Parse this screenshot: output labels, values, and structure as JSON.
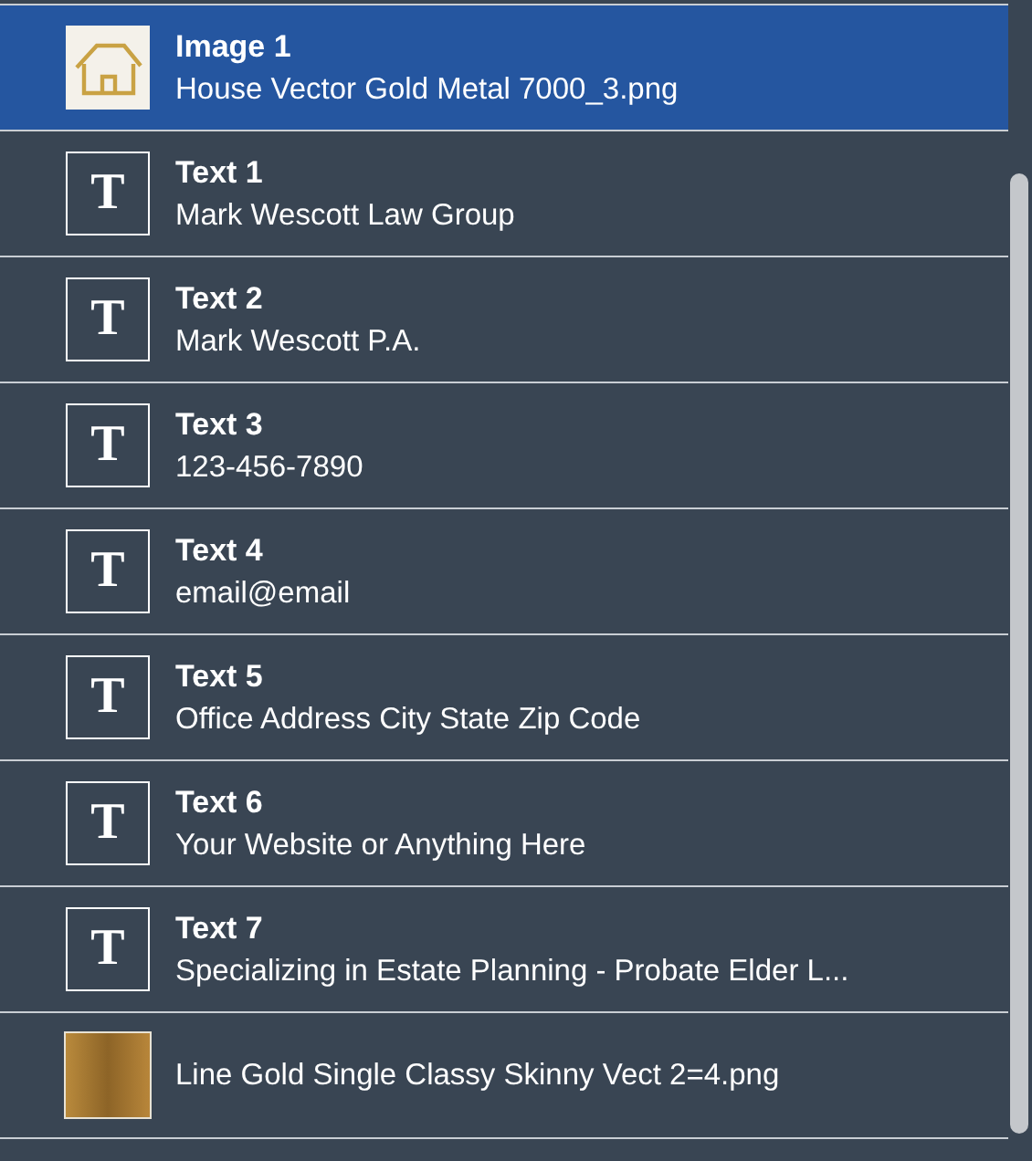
{
  "layers": [
    {
      "kind": "image",
      "title": "Image 1",
      "name": "House Vector Gold Metal 7000_3.png",
      "selected": true
    },
    {
      "kind": "text",
      "glyph": "T",
      "title": "Text 1",
      "name": "Mark Wescott Law Group",
      "selected": false
    },
    {
      "kind": "text",
      "glyph": "T",
      "title": "Text 2",
      "name": "Mark Wescott P.A.",
      "selected": false
    },
    {
      "kind": "text",
      "glyph": "T",
      "title": "Text 3",
      "name": "123-456-7890",
      "selected": false
    },
    {
      "kind": "text",
      "glyph": "T",
      "title": "Text 4",
      "name": "email@email",
      "selected": false
    },
    {
      "kind": "text",
      "glyph": "T",
      "title": "Text 5",
      "name": "Office Address City State Zip Code",
      "selected": false
    },
    {
      "kind": "text",
      "glyph": "T",
      "title": "Text 6",
      "name": "Your Website or Anything Here",
      "selected": false
    },
    {
      "kind": "text",
      "glyph": "T",
      "title": "Text 7",
      "name": "Specializing in Estate Planning - Probate Elder L...",
      "selected": false
    },
    {
      "kind": "line",
      "name": "Line Gold Single Classy Skinny Vect 2=4.png",
      "selected": false
    }
  ]
}
